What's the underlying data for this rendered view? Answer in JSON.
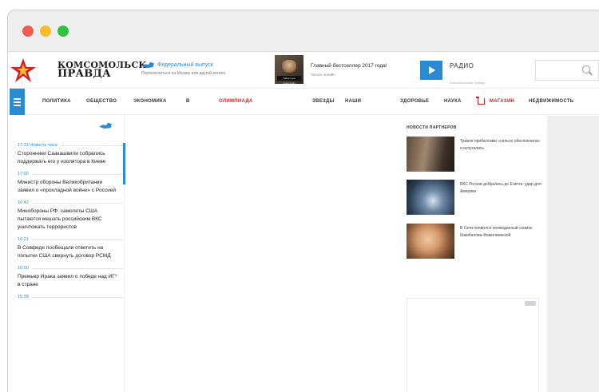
{
  "header": {
    "logo_line1": "КОМСОМОЛЬСК.",
    "logo_line2": "ПРАВДА",
    "federal_title": "Федеральный выпуск",
    "federal_sub": "Переключиться на Москву или другой регион",
    "book_caption": "Тайна горы Самоубийц",
    "bestseller_title": "Главный бестселлер 2017 года!",
    "bestseller_sub": "Читать онлайн",
    "radio_label": "РАДИО",
    "radio_sub": "Комсомольская Правда"
  },
  "nav": {
    "items": [
      "ПОЛИТИКА",
      "ОБЩЕСТВО",
      "ЭКОНОМИКА",
      "В",
      "ОЛИМПИАДА",
      "ЗВЕЗДЫ",
      "НАШИ",
      "ЗДОРОВЬЕ",
      "НАУКА",
      "МАГАЗИН",
      "НЕДВИЖИМОСТЬ"
    ]
  },
  "news": [
    {
      "time": "17:21 Новость часа",
      "title": "Сторонники Саакашвили собрались поддержать его у изолятора в Киеве"
    },
    {
      "time": "17:00",
      "title": "Министр обороны Великобритании заявил о «прохладной войне» с Россией"
    },
    {
      "time": "16:42",
      "title": "Минобороны РФ: самолеты США пытаются мешать российским ВКС уничтожать террористов"
    },
    {
      "time": "16:21",
      "title": "В Совфеде пообещали ответить на попытки США свернуть договор РСМД"
    },
    {
      "time": "16:00",
      "title": "Премьер Ирака заявил о победе над ИГ* в стране"
    },
    {
      "time": "15:38",
      "title": ""
    }
  ],
  "partners": {
    "title": "НОВОСТИ ПАРТНЕРОВ",
    "items": [
      {
        "text": "Травля прибалтами «сильно обеспокоила» и испугались"
      },
      {
        "text": "ВКС России добрались до Египта: удар для Америки"
      },
      {
        "text": "В Сети появился неожиданный снимок Шамбалова-Фамилиевской"
      }
    ]
  },
  "colors": {
    "accent_blue": "#2a8bd5",
    "accent_red": "#d0202a",
    "chrome_gray": "#eeeeee"
  }
}
